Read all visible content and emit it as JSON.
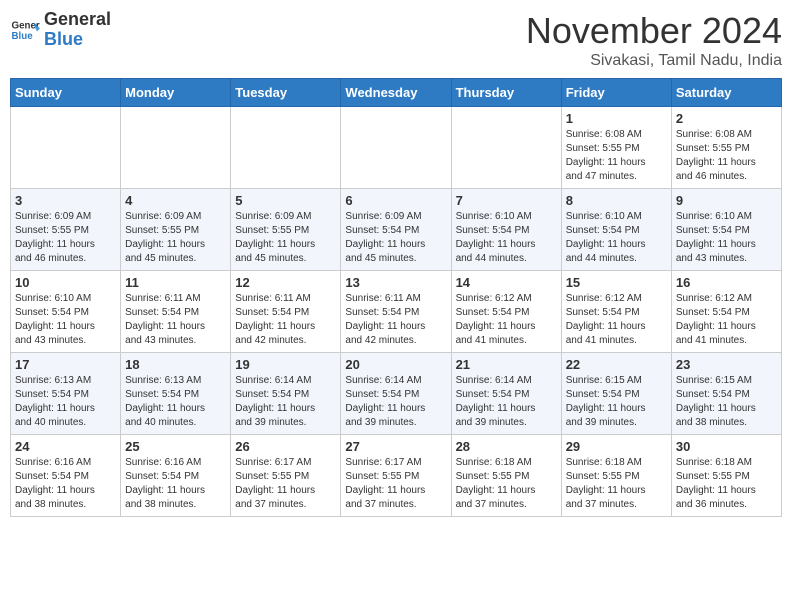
{
  "header": {
    "logo_general": "General",
    "logo_blue": "Blue",
    "month_title": "November 2024",
    "location": "Sivakasi, Tamil Nadu, India"
  },
  "weekdays": [
    "Sunday",
    "Monday",
    "Tuesday",
    "Wednesday",
    "Thursday",
    "Friday",
    "Saturday"
  ],
  "weeks": [
    [
      {
        "day": "",
        "info": ""
      },
      {
        "day": "",
        "info": ""
      },
      {
        "day": "",
        "info": ""
      },
      {
        "day": "",
        "info": ""
      },
      {
        "day": "",
        "info": ""
      },
      {
        "day": "1",
        "info": "Sunrise: 6:08 AM\nSunset: 5:55 PM\nDaylight: 11 hours\nand 47 minutes."
      },
      {
        "day": "2",
        "info": "Sunrise: 6:08 AM\nSunset: 5:55 PM\nDaylight: 11 hours\nand 46 minutes."
      }
    ],
    [
      {
        "day": "3",
        "info": "Sunrise: 6:09 AM\nSunset: 5:55 PM\nDaylight: 11 hours\nand 46 minutes."
      },
      {
        "day": "4",
        "info": "Sunrise: 6:09 AM\nSunset: 5:55 PM\nDaylight: 11 hours\nand 45 minutes."
      },
      {
        "day": "5",
        "info": "Sunrise: 6:09 AM\nSunset: 5:55 PM\nDaylight: 11 hours\nand 45 minutes."
      },
      {
        "day": "6",
        "info": "Sunrise: 6:09 AM\nSunset: 5:54 PM\nDaylight: 11 hours\nand 45 minutes."
      },
      {
        "day": "7",
        "info": "Sunrise: 6:10 AM\nSunset: 5:54 PM\nDaylight: 11 hours\nand 44 minutes."
      },
      {
        "day": "8",
        "info": "Sunrise: 6:10 AM\nSunset: 5:54 PM\nDaylight: 11 hours\nand 44 minutes."
      },
      {
        "day": "9",
        "info": "Sunrise: 6:10 AM\nSunset: 5:54 PM\nDaylight: 11 hours\nand 43 minutes."
      }
    ],
    [
      {
        "day": "10",
        "info": "Sunrise: 6:10 AM\nSunset: 5:54 PM\nDaylight: 11 hours\nand 43 minutes."
      },
      {
        "day": "11",
        "info": "Sunrise: 6:11 AM\nSunset: 5:54 PM\nDaylight: 11 hours\nand 43 minutes."
      },
      {
        "day": "12",
        "info": "Sunrise: 6:11 AM\nSunset: 5:54 PM\nDaylight: 11 hours\nand 42 minutes."
      },
      {
        "day": "13",
        "info": "Sunrise: 6:11 AM\nSunset: 5:54 PM\nDaylight: 11 hours\nand 42 minutes."
      },
      {
        "day": "14",
        "info": "Sunrise: 6:12 AM\nSunset: 5:54 PM\nDaylight: 11 hours\nand 41 minutes."
      },
      {
        "day": "15",
        "info": "Sunrise: 6:12 AM\nSunset: 5:54 PM\nDaylight: 11 hours\nand 41 minutes."
      },
      {
        "day": "16",
        "info": "Sunrise: 6:12 AM\nSunset: 5:54 PM\nDaylight: 11 hours\nand 41 minutes."
      }
    ],
    [
      {
        "day": "17",
        "info": "Sunrise: 6:13 AM\nSunset: 5:54 PM\nDaylight: 11 hours\nand 40 minutes."
      },
      {
        "day": "18",
        "info": "Sunrise: 6:13 AM\nSunset: 5:54 PM\nDaylight: 11 hours\nand 40 minutes."
      },
      {
        "day": "19",
        "info": "Sunrise: 6:14 AM\nSunset: 5:54 PM\nDaylight: 11 hours\nand 39 minutes."
      },
      {
        "day": "20",
        "info": "Sunrise: 6:14 AM\nSunset: 5:54 PM\nDaylight: 11 hours\nand 39 minutes."
      },
      {
        "day": "21",
        "info": "Sunrise: 6:14 AM\nSunset: 5:54 PM\nDaylight: 11 hours\nand 39 minutes."
      },
      {
        "day": "22",
        "info": "Sunrise: 6:15 AM\nSunset: 5:54 PM\nDaylight: 11 hours\nand 39 minutes."
      },
      {
        "day": "23",
        "info": "Sunrise: 6:15 AM\nSunset: 5:54 PM\nDaylight: 11 hours\nand 38 minutes."
      }
    ],
    [
      {
        "day": "24",
        "info": "Sunrise: 6:16 AM\nSunset: 5:54 PM\nDaylight: 11 hours\nand 38 minutes."
      },
      {
        "day": "25",
        "info": "Sunrise: 6:16 AM\nSunset: 5:54 PM\nDaylight: 11 hours\nand 38 minutes."
      },
      {
        "day": "26",
        "info": "Sunrise: 6:17 AM\nSunset: 5:55 PM\nDaylight: 11 hours\nand 37 minutes."
      },
      {
        "day": "27",
        "info": "Sunrise: 6:17 AM\nSunset: 5:55 PM\nDaylight: 11 hours\nand 37 minutes."
      },
      {
        "day": "28",
        "info": "Sunrise: 6:18 AM\nSunset: 5:55 PM\nDaylight: 11 hours\nand 37 minutes."
      },
      {
        "day": "29",
        "info": "Sunrise: 6:18 AM\nSunset: 5:55 PM\nDaylight: 11 hours\nand 37 minutes."
      },
      {
        "day": "30",
        "info": "Sunrise: 6:18 AM\nSunset: 5:55 PM\nDaylight: 11 hours\nand 36 minutes."
      }
    ]
  ]
}
